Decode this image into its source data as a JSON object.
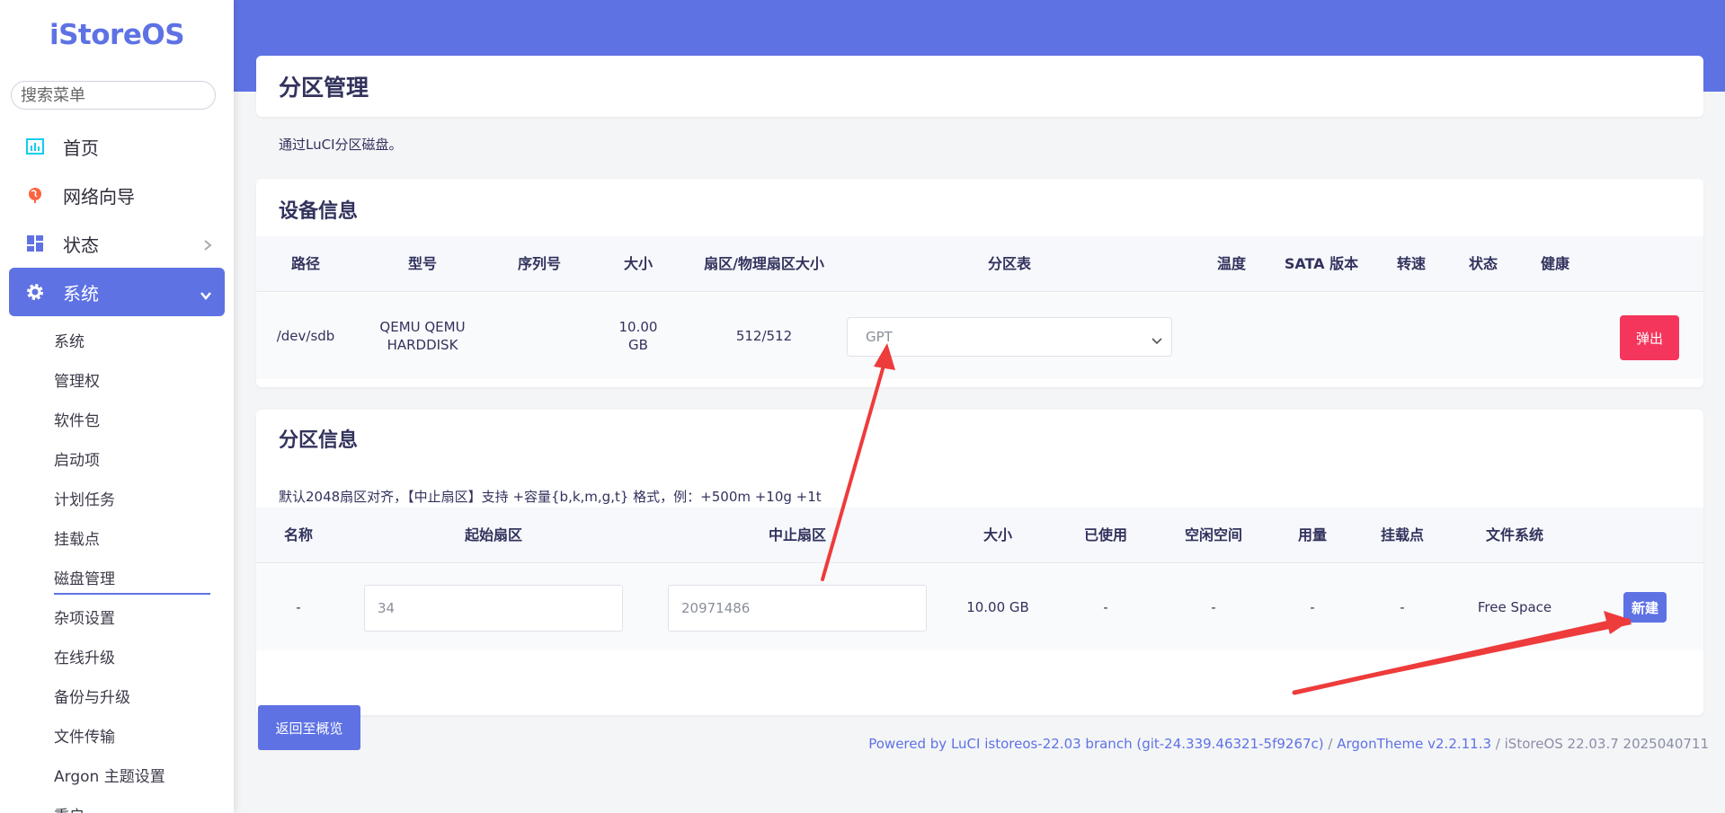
{
  "sidebar": {
    "logo": "iStoreOS",
    "search_placeholder": "搜索菜单",
    "items": [
      {
        "label": "首页",
        "icon": "chart-icon"
      },
      {
        "label": "网络向导",
        "icon": "globe-icon"
      },
      {
        "label": "状态",
        "icon": "grid-icon"
      },
      {
        "label": "系统",
        "icon": "gear-icon"
      }
    ],
    "subitems": [
      "系统",
      "管理权",
      "软件包",
      "启动项",
      "计划任务",
      "挂载点",
      "磁盘管理",
      "杂项设置",
      "在线升级",
      "备份与升级",
      "文件传输",
      "Argon 主题设置",
      "重启"
    ],
    "current_subitem": "磁盘管理"
  },
  "page": {
    "title": "分区管理",
    "description": "通过LuCI分区磁盘。"
  },
  "device": {
    "title": "设备信息",
    "headers": [
      "路径",
      "型号",
      "序列号",
      "大小",
      "扇区/物理扇区大小",
      "分区表",
      "温度",
      "SATA 版本",
      "转速",
      "状态",
      "健康"
    ],
    "row": {
      "path": "/dev/sdb",
      "model_line1": "QEMU QEMU",
      "model_line2": "HARDDISK",
      "serial": "",
      "size_line1": "10.00",
      "size_line2": "GB",
      "sector": "512/512",
      "partition_table": "GPT"
    },
    "eject_label": "弹出"
  },
  "partition": {
    "title": "分区信息",
    "note": "默认2048扇区对齐，【中止扇区】支持 +容量{b,k,m,g,t} 格式，例：+500m +10g +1t",
    "headers": [
      "名称",
      "起始扇区",
      "中止扇区",
      "大小",
      "已使用",
      "空闲空间",
      "用量",
      "挂载点",
      "文件系统"
    ],
    "row": {
      "name": "-",
      "start_sector": "34",
      "end_sector": "20971486",
      "size": "10.00 GB",
      "used": "-",
      "free": "-",
      "usage": "-",
      "mount": "-",
      "filesystem": "Free Space"
    },
    "new_label": "新建"
  },
  "back_label": "返回至概览",
  "footer": {
    "luci": "Powered by LuCI istoreos-22.03 branch (git-24.339.46321-5f9267c)",
    "sep1": " / ",
    "theme": "ArgonTheme v2.2.11.3",
    "sep2": " / ",
    "version": "iStoreOS 22.03.7 2025040711"
  },
  "colors": {
    "accent": "#5e72e4",
    "danger": "#f5365c",
    "annotation_arrow": "#ee3b3b"
  }
}
